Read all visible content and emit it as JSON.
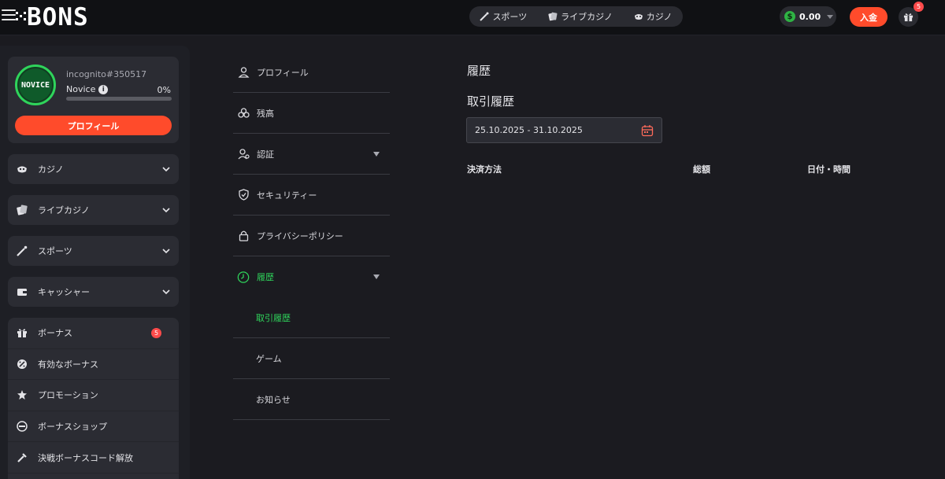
{
  "header": {
    "logo": "BONS",
    "nav": [
      {
        "label": "スポーツ",
        "icon": "sports-icon"
      },
      {
        "label": "ライブカジノ",
        "icon": "live-casino-icon"
      },
      {
        "label": "カジノ",
        "icon": "casino-icon"
      }
    ],
    "balance": "0.00",
    "currency_symbol": "$",
    "deposit_label": "入金",
    "gift_count": "5"
  },
  "profile": {
    "avatar_text": "NOVICE",
    "username": "incognito#350517",
    "level": "Novice",
    "level_percent": "0%",
    "progress": 0,
    "button_label": "プロフィール"
  },
  "sidebar": {
    "menus": [
      {
        "label": "カジノ",
        "icon": "casino-icon"
      },
      {
        "label": "ライブカジノ",
        "icon": "live-casino-icon"
      },
      {
        "label": "スポーツ",
        "icon": "sports-icon"
      },
      {
        "label": "キャッシャー",
        "icon": "wallet-icon"
      }
    ],
    "bonus_items": [
      {
        "label": "ボーナス",
        "icon": "gift-icon",
        "badge": "5"
      },
      {
        "label": "有効なボーナス",
        "icon": "active-bonus-icon"
      },
      {
        "label": "プロモーション",
        "icon": "promotion-icon"
      },
      {
        "label": "ボーナスショップ",
        "icon": "shop-icon"
      },
      {
        "label": "決戦ボーナスコード解放",
        "icon": "code-icon"
      }
    ]
  },
  "account_menu": {
    "items": [
      {
        "label": "プロフィール",
        "icon": "user-icon"
      },
      {
        "label": "残高",
        "icon": "coins-icon"
      },
      {
        "label": "認証",
        "icon": "verification-icon"
      },
      {
        "label": "セキュリティー",
        "icon": "shield-icon"
      },
      {
        "label": "プライバシーポリシー",
        "icon": "lock-icon"
      },
      {
        "label": "履歴",
        "icon": "history-icon"
      },
      {
        "label": "取引履歴"
      },
      {
        "label": "ゲーム"
      },
      {
        "label": "お知らせ"
      }
    ]
  },
  "content": {
    "title": "履歴",
    "subtitle": "取引履歴",
    "date_range": "25.10.2025 - 31.10.2025",
    "table_headers": [
      "決済方法",
      "総額",
      "日付・時間"
    ]
  },
  "colors": {
    "accent": "#ff4b2b",
    "active_green": "#2fd45b",
    "background": "#1b1b20",
    "panel": "#2b2c33"
  }
}
